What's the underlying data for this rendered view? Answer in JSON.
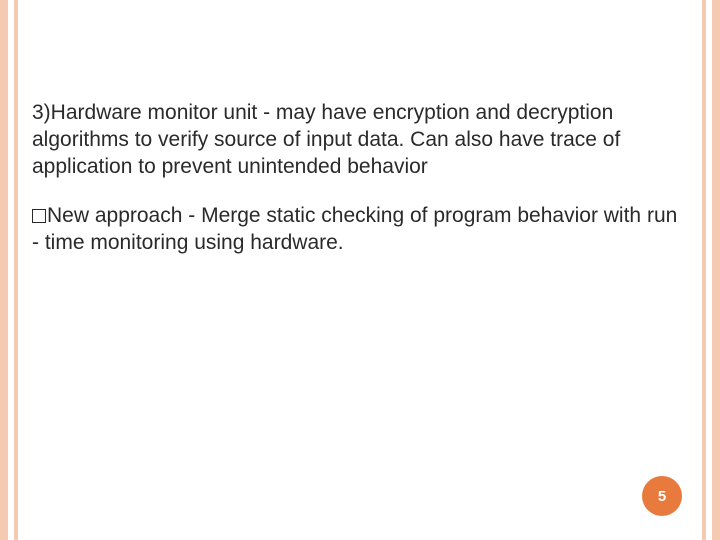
{
  "slide": {
    "paragraph1": "3)Hardware monitor unit - may have encryption and decryption algorithms to verify source of input data. Can also have trace of application to prevent unintended behavior",
    "paragraph2_text": "New approach - Merge static checking of program behavior with run - time monitoring using hardware.",
    "page_number": "5"
  },
  "theme": {
    "stripe_color": "#f4cbb2",
    "badge_color": "#e77a3c"
  }
}
